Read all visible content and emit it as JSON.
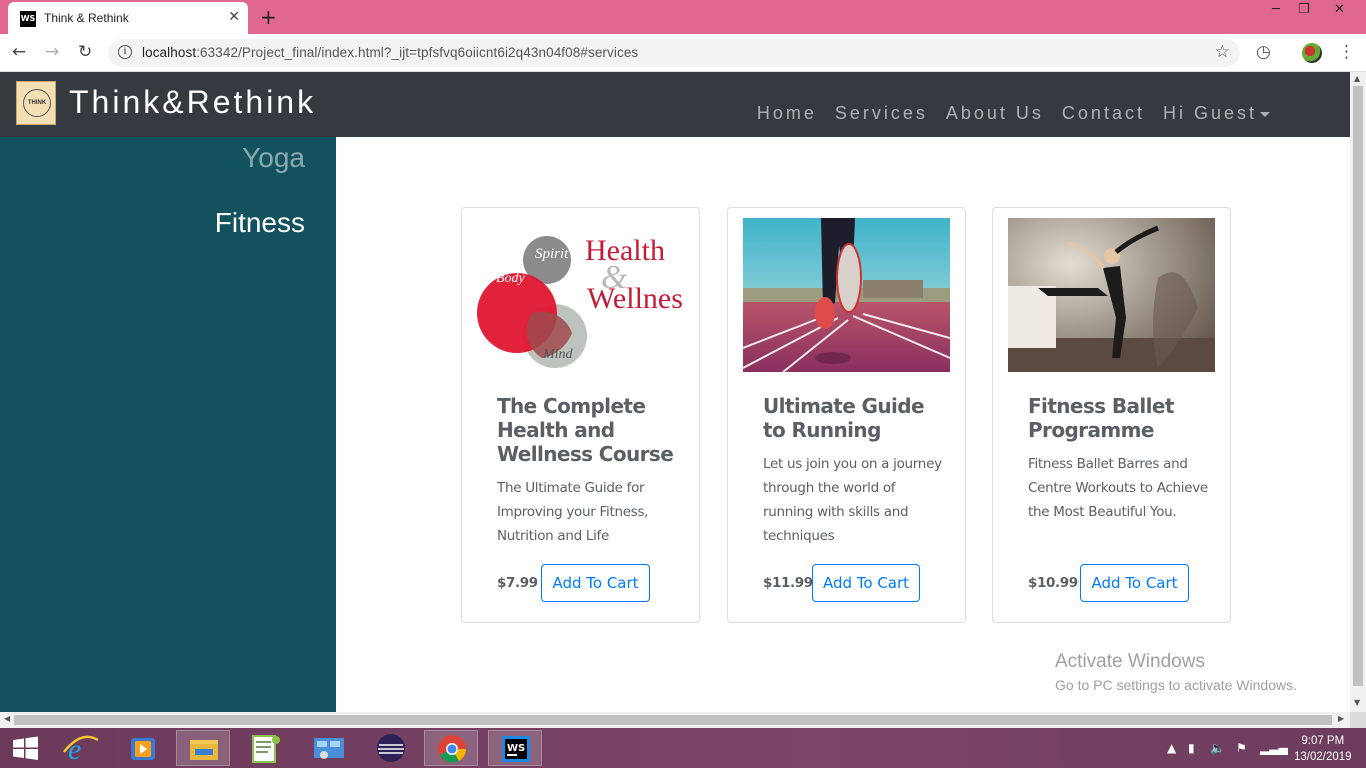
{
  "browser": {
    "tab_title": "Think & Rethink",
    "tab_favicon": "WS",
    "url_host": "localhost",
    "url_rest": ":63342/Project_final/index.html?_ijt=tpfsfvq6oiicnt6i2q43n04f08#services"
  },
  "site": {
    "logo_text": "THINK",
    "brand": "Think&Rethink",
    "nav": [
      "Home",
      "Services",
      "About Us",
      "Contact",
      "Hi Guest"
    ]
  },
  "sidebar": {
    "items": [
      "Yoga",
      "Fitness"
    ]
  },
  "cards": [
    {
      "title": "The Complete Health and Wellness Course",
      "text": "The Ultimate Guide for Improving your Fitness, Nutrition and Life",
      "price": "$7.99",
      "button": "Add To Cart",
      "image": {
        "spirit": "Spirit",
        "body": "Body",
        "mind": "Mind",
        "health": "Health",
        "amp": "&",
        "wellness": "Wellness"
      }
    },
    {
      "title": "Ultimate Guide to Running",
      "text": "Let us join you on a journey through the world of running with skills and techniques",
      "price": "$11.99",
      "button": "Add To Cart"
    },
    {
      "title": "Fitness Ballet Programme",
      "text": "Fitness Ballet Barres and Centre Workouts to Achieve the Most Beautiful You.",
      "price": "$10.99",
      "button": "Add To Cart"
    }
  ],
  "watermark": {
    "line1": "Activate Windows",
    "line2": "Go to PC settings to activate Windows."
  },
  "taskbar": {
    "time": "9:07 PM",
    "date": "13/02/2019"
  }
}
